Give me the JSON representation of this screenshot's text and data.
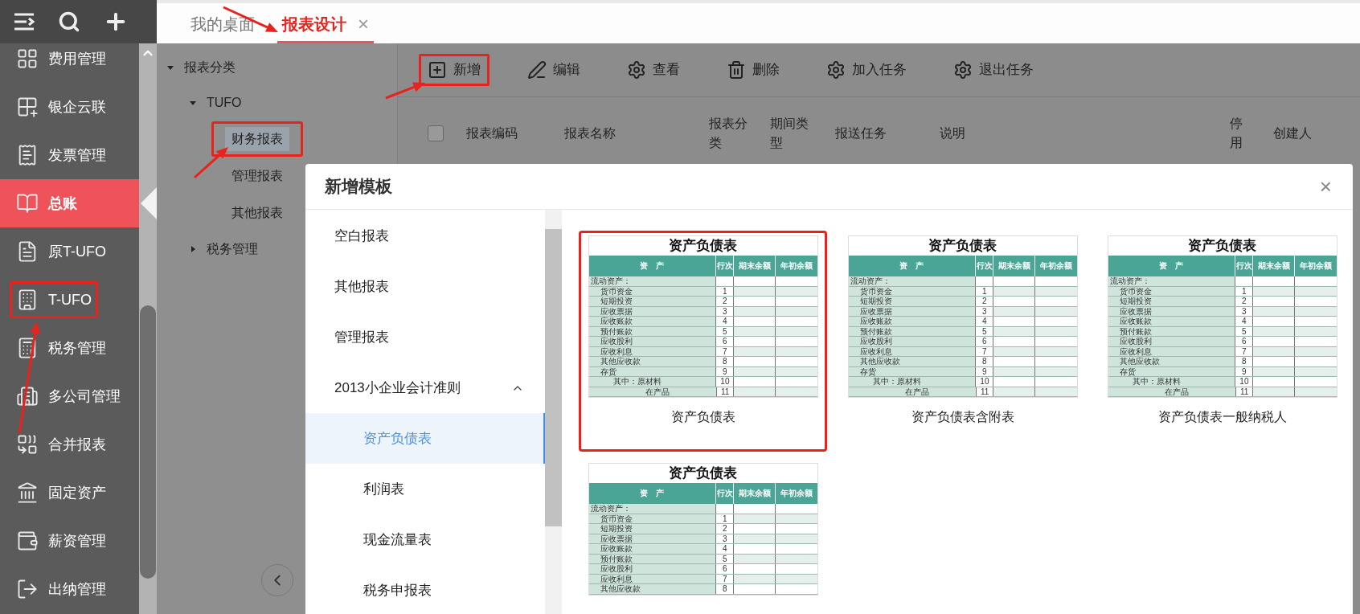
{
  "sidebar": {
    "items": [
      {
        "label": "费用管理",
        "selected": false,
        "highlighted": false
      },
      {
        "label": "银企云联",
        "selected": false,
        "highlighted": false
      },
      {
        "label": "发票管理",
        "selected": false,
        "highlighted": false
      },
      {
        "label": "总账",
        "selected": true,
        "highlighted": false
      },
      {
        "label": "原T-UFO",
        "selected": false,
        "highlighted": false
      },
      {
        "label": "T-UFO",
        "selected": false,
        "highlighted": true
      },
      {
        "label": "税务管理",
        "selected": false,
        "highlighted": false
      },
      {
        "label": "多公司管理",
        "selected": false,
        "highlighted": false
      },
      {
        "label": "合并报表",
        "selected": false,
        "highlighted": false
      },
      {
        "label": "固定资产",
        "selected": false,
        "highlighted": false
      },
      {
        "label": "薪资管理",
        "selected": false,
        "highlighted": false
      },
      {
        "label": "出纳管理",
        "selected": false,
        "highlighted": false
      }
    ]
  },
  "tabs": [
    {
      "label": "我的桌面",
      "selected": false
    },
    {
      "label": "报表设计",
      "selected": true,
      "close": "×"
    }
  ],
  "tree": [
    {
      "label": "报表分类",
      "expanded": true,
      "children": [
        {
          "label": "TUFO",
          "expanded": true,
          "children": [
            {
              "label": "财务报表",
              "selected": true,
              "highlighted": true
            },
            {
              "label": "管理报表",
              "selected": false,
              "highlighted": false
            },
            {
              "label": "其他报表",
              "selected": false,
              "highlighted": false
            }
          ]
        },
        {
          "label": "税务管理",
          "expanded": false
        }
      ]
    }
  ],
  "toolbar": [
    {
      "label": "新增",
      "highlighted": true
    },
    {
      "label": "编辑",
      "highlighted": false
    },
    {
      "label": "查看",
      "highlighted": false
    },
    {
      "label": "删除",
      "highlighted": false
    },
    {
      "label": "加入任务",
      "highlighted": false
    },
    {
      "label": "退出任务",
      "highlighted": false
    }
  ],
  "table": {
    "select_all": {
      "checked": false
    },
    "columns": [
      "报表编码",
      "报表名称",
      "报表分类",
      "期间类型",
      "报送任务",
      "说明",
      "停用",
      "创建人"
    ]
  },
  "dialog": {
    "title": "新增模板",
    "close": "×",
    "categories": [
      {
        "label": "空白报表",
        "selected": false
      },
      {
        "label": "其他报表",
        "selected": false
      },
      {
        "label": "管理报表",
        "selected": false
      },
      {
        "label": "2013小企业会计准则",
        "expanded": true,
        "children": [
          {
            "label": "资产负债表",
            "selected": true
          },
          {
            "label": "利润表",
            "selected": false
          },
          {
            "label": "现金流量表",
            "selected": false
          },
          {
            "label": "税务申报表",
            "selected": false
          }
        ]
      }
    ],
    "templates": [
      {
        "caption": "资产负债表",
        "highlighted": true,
        "preview": {
          "title": "资产负债表",
          "header": [
            "资　产",
            "行次",
            "期末余额",
            "年初余额"
          ],
          "rows": [
            {
              "label": "流动资产：",
              "no": "",
              "kind": "heading"
            },
            {
              "label": "货币资金",
              "no": "1",
              "kind": "item"
            },
            {
              "label": "短期投资",
              "no": "2",
              "kind": "item"
            },
            {
              "label": "应收票据",
              "no": "3",
              "kind": "item"
            },
            {
              "label": "应收账款",
              "no": "4",
              "kind": "item"
            },
            {
              "label": "预付账款",
              "no": "5",
              "kind": "item"
            },
            {
              "label": "应收股利",
              "no": "6",
              "kind": "item"
            },
            {
              "label": "应收利息",
              "no": "7",
              "kind": "item"
            },
            {
              "label": "其他应收款",
              "no": "8",
              "kind": "item"
            },
            {
              "label": "存货",
              "no": "9",
              "kind": "item"
            },
            {
              "label": "其中：原材料",
              "no": "10",
              "kind": "sub"
            },
            {
              "label": "在产品",
              "no": "11",
              "kind": "subsub"
            }
          ]
        }
      },
      {
        "caption": "资产负债表含附表",
        "highlighted": false,
        "preview": {
          "title": "资产负债表",
          "header": [
            "资　产",
            "行次",
            "期末余额",
            "年初余额"
          ],
          "rows": [
            {
              "label": "流动资产：",
              "no": "",
              "kind": "heading"
            },
            {
              "label": "货币资金",
              "no": "1",
              "kind": "item"
            },
            {
              "label": "短期投资",
              "no": "2",
              "kind": "item"
            },
            {
              "label": "应收票据",
              "no": "3",
              "kind": "item"
            },
            {
              "label": "应收账款",
              "no": "4",
              "kind": "item"
            },
            {
              "label": "预付账款",
              "no": "5",
              "kind": "item"
            },
            {
              "label": "应收股利",
              "no": "6",
              "kind": "item"
            },
            {
              "label": "应收利息",
              "no": "7",
              "kind": "item"
            },
            {
              "label": "其他应收款",
              "no": "8",
              "kind": "item"
            },
            {
              "label": "存货",
              "no": "9",
              "kind": "item"
            },
            {
              "label": "其中：原材料",
              "no": "10",
              "kind": "sub"
            },
            {
              "label": "在产品",
              "no": "11",
              "kind": "subsub"
            }
          ]
        }
      },
      {
        "caption": "资产负债表一般纳税人",
        "highlighted": false,
        "preview": {
          "title": "资产负债表",
          "header": [
            "资　产",
            "行次",
            "期末余额",
            "年初余额"
          ],
          "rows": [
            {
              "label": "流动资产：",
              "no": "",
              "kind": "heading"
            },
            {
              "label": "货币资金",
              "no": "1",
              "kind": "item"
            },
            {
              "label": "短期投资",
              "no": "2",
              "kind": "item"
            },
            {
              "label": "应收票据",
              "no": "3",
              "kind": "item"
            },
            {
              "label": "应收账款",
              "no": "4",
              "kind": "item"
            },
            {
              "label": "预付账款",
              "no": "5",
              "kind": "item"
            },
            {
              "label": "应收股利",
              "no": "6",
              "kind": "item"
            },
            {
              "label": "应收利息",
              "no": "7",
              "kind": "item"
            },
            {
              "label": "其他应收款",
              "no": "8",
              "kind": "item"
            },
            {
              "label": "存货",
              "no": "9",
              "kind": "item"
            },
            {
              "label": "其中：原材料",
              "no": "10",
              "kind": "sub"
            },
            {
              "label": "在产品",
              "no": "11",
              "kind": "subsub"
            }
          ]
        }
      },
      {
        "highlighted": false,
        "preview": {
          "title": "资产负债表",
          "header": [
            "资　产",
            "行次",
            "期末余额",
            "年初余额"
          ],
          "rows": [
            {
              "label": "流动资产：",
              "no": "",
              "kind": "heading"
            },
            {
              "label": "货币资金",
              "no": "1",
              "kind": "item"
            },
            {
              "label": "短期投资",
              "no": "2",
              "kind": "item"
            },
            {
              "label": "应收票据",
              "no": "3",
              "kind": "item"
            },
            {
              "label": "应收账款",
              "no": "4",
              "kind": "item"
            },
            {
              "label": "预付账款",
              "no": "5",
              "kind": "item"
            },
            {
              "label": "应收股利",
              "no": "6",
              "kind": "item"
            },
            {
              "label": "应收利息",
              "no": "7",
              "kind": "item"
            },
            {
              "label": "其他应收款",
              "no": "8",
              "kind": "item"
            }
          ]
        }
      }
    ]
  }
}
